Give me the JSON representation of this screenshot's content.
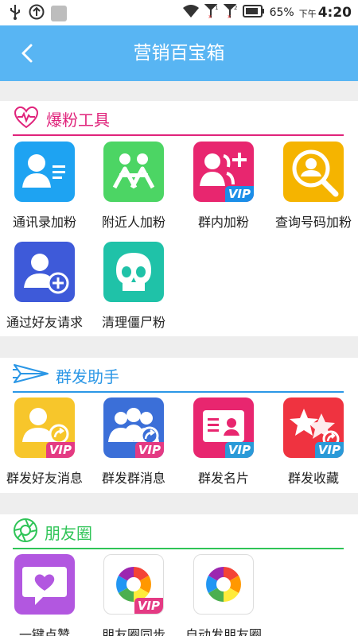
{
  "status": {
    "battery": "65%",
    "time_prefix": "下午",
    "time": "4:20"
  },
  "header": {
    "title": "营销百宝箱"
  },
  "sections": [
    {
      "title": "爆粉工具",
      "color": "#e0237b",
      "items": [
        {
          "label": "通讯录加粉",
          "vip": false
        },
        {
          "label": "附近人加粉",
          "vip": false
        },
        {
          "label": "群内加粉",
          "vip": true
        },
        {
          "label": "查询号码加粉",
          "vip": false
        },
        {
          "label": "通过好友请求",
          "vip": false
        },
        {
          "label": "清理僵尸粉",
          "vip": false
        }
      ]
    },
    {
      "title": "群发助手",
      "color": "#2b97e6",
      "items": [
        {
          "label": "群发好友消息",
          "vip": true
        },
        {
          "label": "群发群消息",
          "vip": true
        },
        {
          "label": "群发名片",
          "vip": true
        },
        {
          "label": "群发收藏",
          "vip": true
        }
      ]
    },
    {
      "title": "朋友圈",
      "color": "#2fc457",
      "items": [
        {
          "label": "一键点赞",
          "vip": false
        },
        {
          "label": "朋友圈同步",
          "vip": true
        },
        {
          "label": "自动发朋友圈",
          "vip": false
        }
      ]
    }
  ],
  "vip_text": "VIP"
}
